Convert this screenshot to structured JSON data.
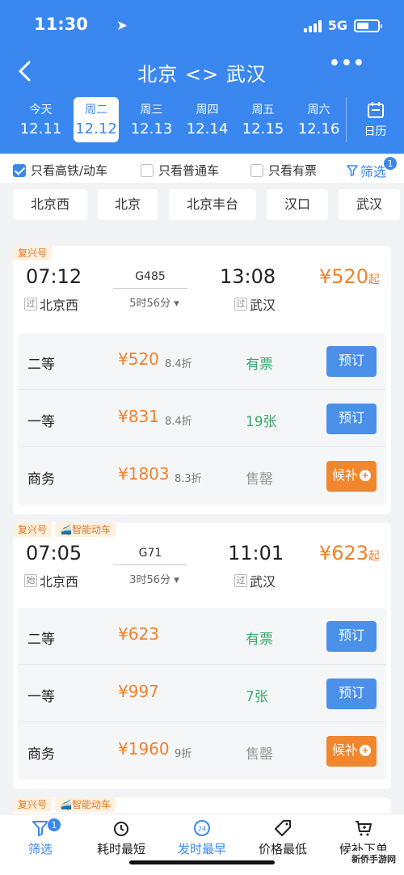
{
  "status": {
    "time": "11:30",
    "network": "5G"
  },
  "nav": {
    "route": "北京 <> 武汉",
    "more": "•••"
  },
  "dates": [
    {
      "weekday": "今天",
      "date": "12.11",
      "active": false
    },
    {
      "weekday": "周二",
      "date": "12.12",
      "active": true
    },
    {
      "weekday": "周三",
      "date": "12.13",
      "active": false
    },
    {
      "weekday": "周四",
      "date": "12.14",
      "active": false
    },
    {
      "weekday": "周五",
      "date": "12.15",
      "active": false
    },
    {
      "weekday": "周六",
      "date": "12.16",
      "active": false
    }
  ],
  "calendar_label": "日历",
  "filters": {
    "high_speed": {
      "label": "只看高铁/动车",
      "checked": true
    },
    "normal": {
      "label": "只看普通车",
      "checked": false
    },
    "available": {
      "label": "只看有票",
      "checked": false
    },
    "screen_label": "筛选",
    "screen_badge": "1"
  },
  "stations": [
    "北京西",
    "北京",
    "北京丰台",
    "汉口",
    "武汉"
  ],
  "trains": [
    {
      "tags": [
        "复兴号"
      ],
      "depart_time": "07:12",
      "arrive_time": "13:08",
      "train_no": "G485",
      "duration": "5时56分",
      "from_mark": "过",
      "from": "北京西",
      "to_mark": "过",
      "to": "武汉",
      "price": "¥520",
      "price_suffix": "起",
      "seats": [
        {
          "class": "二等",
          "price": "¥520",
          "discount": "8.4折",
          "avail": "有票",
          "action": "预订"
        },
        {
          "class": "一等",
          "price": "¥831",
          "discount": "8.4折",
          "avail": "19张",
          "action": "预订"
        },
        {
          "class": "商务",
          "price": "¥1803",
          "discount": "8.3折",
          "avail": "售罄",
          "action": "候补"
        }
      ]
    },
    {
      "tags": [
        "复兴号",
        "智能动车"
      ],
      "depart_time": "07:05",
      "arrive_time": "11:01",
      "train_no": "G71",
      "duration": "3时56分",
      "from_mark": "始",
      "from": "北京西",
      "to_mark": "过",
      "to": "武汉",
      "price": "¥623",
      "price_suffix": "起",
      "seats": [
        {
          "class": "二等",
          "price": "¥623",
          "discount": "",
          "avail": "有票",
          "action": "预订"
        },
        {
          "class": "一等",
          "price": "¥997",
          "discount": "",
          "avail": "7张",
          "action": "预订"
        },
        {
          "class": "商务",
          "price": "¥1960",
          "discount": "9折",
          "avail": "售罄",
          "action": "候补"
        }
      ]
    }
  ],
  "next_tags": [
    "复兴号",
    "智能动车"
  ],
  "tabbar": {
    "filter": "筛选",
    "filter_badge": "1",
    "shortest": "耗时最短",
    "earliest": "发时最早",
    "earliest_icon_text": "24",
    "cheapest": "价格最低",
    "waitlist": "候补下单"
  },
  "watermark": "新侨手游网",
  "colors": {
    "brand": "#3a87ef",
    "price": "#f0812b",
    "available": "#3aa76d",
    "waitlist": "#f0862e"
  }
}
